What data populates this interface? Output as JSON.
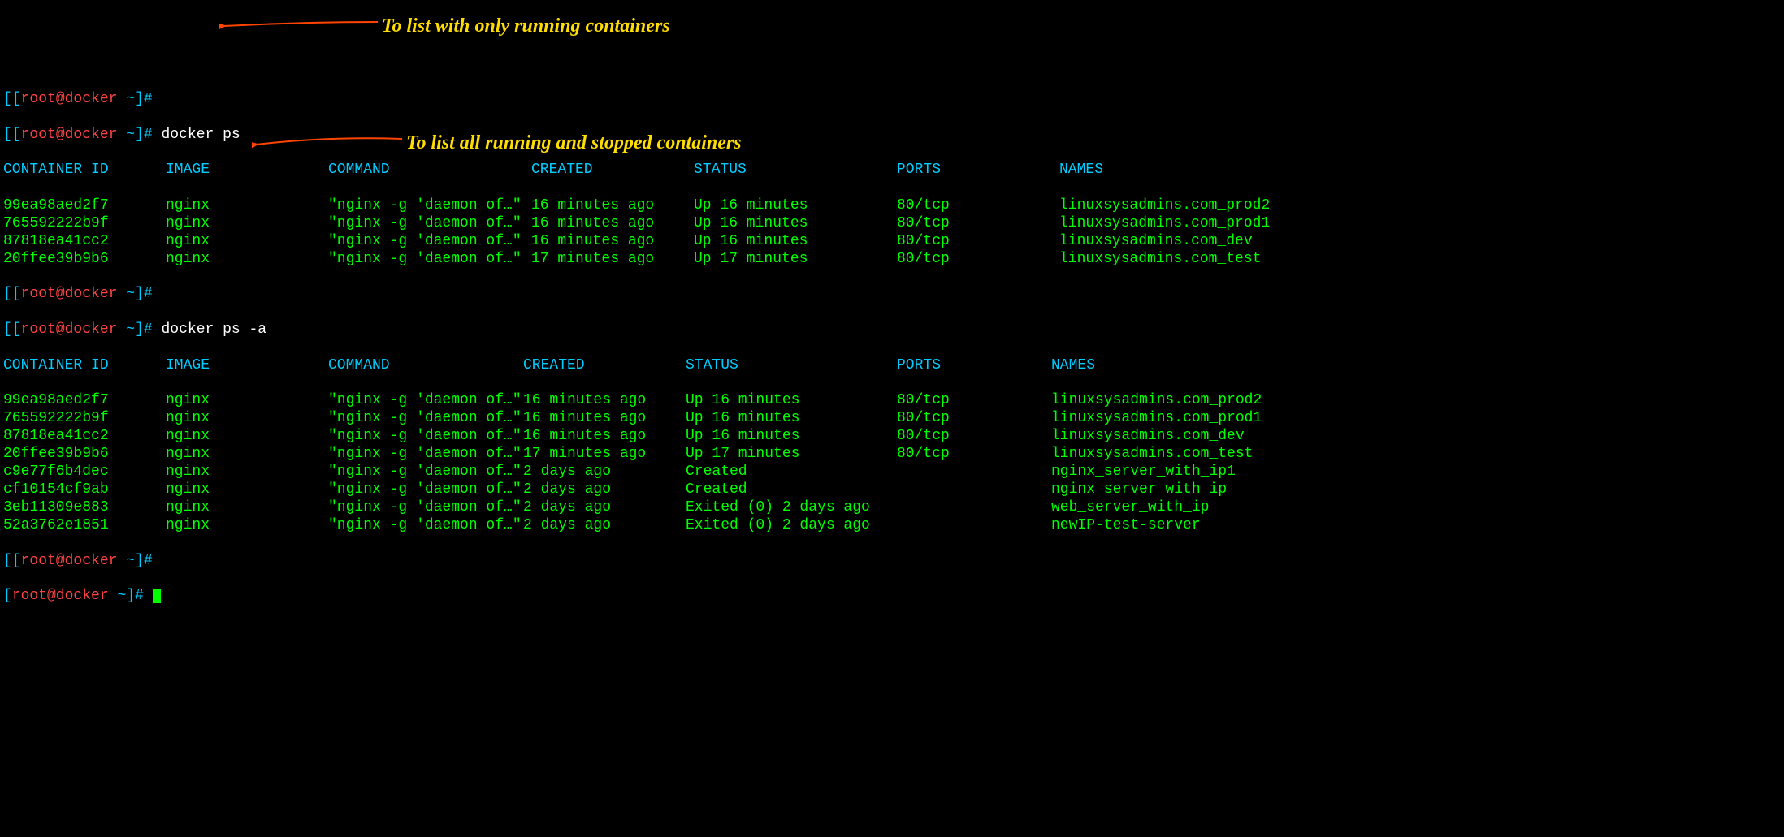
{
  "prompt": {
    "bracket_open": "[",
    "bracket_close": "]#",
    "user_host": "root@docker",
    "path": " ~"
  },
  "commands": {
    "docker_ps": "docker ps",
    "docker_ps_a": "docker ps -a"
  },
  "annotations": {
    "running": "To list with only running containers",
    "all": "To list all running and stopped containers"
  },
  "headers": {
    "container_id": "CONTAINER ID",
    "image": "IMAGE",
    "command": "COMMAND",
    "created": "CREATED",
    "status": "STATUS",
    "ports": "PORTS",
    "names": "NAMES"
  },
  "running_containers": [
    {
      "id": "99ea98aed2f7",
      "image": "nginx",
      "command": "\"nginx -g 'daemon of…\"",
      "created": "16 minutes ago",
      "status": "Up 16 minutes",
      "ports": "80/tcp",
      "names": "linuxsysadmins.com_prod2"
    },
    {
      "id": "765592222b9f",
      "image": "nginx",
      "command": "\"nginx -g 'daemon of…\"",
      "created": "16 minutes ago",
      "status": "Up 16 minutes",
      "ports": "80/tcp",
      "names": "linuxsysadmins.com_prod1"
    },
    {
      "id": "87818ea41cc2",
      "image": "nginx",
      "command": "\"nginx -g 'daemon of…\"",
      "created": "16 minutes ago",
      "status": "Up 16 minutes",
      "ports": "80/tcp",
      "names": "linuxsysadmins.com_dev"
    },
    {
      "id": "20ffee39b9b6",
      "image": "nginx",
      "command": "\"nginx -g 'daemon of…\"",
      "created": "17 minutes ago",
      "status": "Up 17 minutes",
      "ports": "80/tcp",
      "names": "linuxsysadmins.com_test"
    }
  ],
  "all_containers": [
    {
      "id": "99ea98aed2f7",
      "image": "nginx",
      "command": "\"nginx -g 'daemon of…\"",
      "created": "16 minutes ago",
      "status": "Up 16 minutes",
      "ports": "80/tcp",
      "names": "linuxsysadmins.com_prod2"
    },
    {
      "id": "765592222b9f",
      "image": "nginx",
      "command": "\"nginx -g 'daemon of…\"",
      "created": "16 minutes ago",
      "status": "Up 16 minutes",
      "ports": "80/tcp",
      "names": "linuxsysadmins.com_prod1"
    },
    {
      "id": "87818ea41cc2",
      "image": "nginx",
      "command": "\"nginx -g 'daemon of…\"",
      "created": "16 minutes ago",
      "status": "Up 16 minutes",
      "ports": "80/tcp",
      "names": "linuxsysadmins.com_dev"
    },
    {
      "id": "20ffee39b9b6",
      "image": "nginx",
      "command": "\"nginx -g 'daemon of…\"",
      "created": "17 minutes ago",
      "status": "Up 17 minutes",
      "ports": "80/tcp",
      "names": "linuxsysadmins.com_test"
    },
    {
      "id": "c9e77f6b4dec",
      "image": "nginx",
      "command": "\"nginx -g 'daemon of…\"",
      "created": "2 days ago",
      "status": "Created",
      "ports": "",
      "names": "nginx_server_with_ip1"
    },
    {
      "id": "cf10154cf9ab",
      "image": "nginx",
      "command": "\"nginx -g 'daemon of…\"",
      "created": "2 days ago",
      "status": "Created",
      "ports": "",
      "names": "nginx_server_with_ip"
    },
    {
      "id": "3eb11309e883",
      "image": "nginx",
      "command": "\"nginx -g 'daemon of…\"",
      "created": "2 days ago",
      "status": "Exited (0) 2 days ago",
      "ports": "",
      "names": "web_server_with_ip"
    },
    {
      "id": "52a3762e1851",
      "image": "nginx",
      "command": "\"nginx -g 'daemon of…\"",
      "created": "2 days ago",
      "status": "Exited (0) 2 days ago",
      "ports": "",
      "names": "newIP-test-server"
    }
  ]
}
